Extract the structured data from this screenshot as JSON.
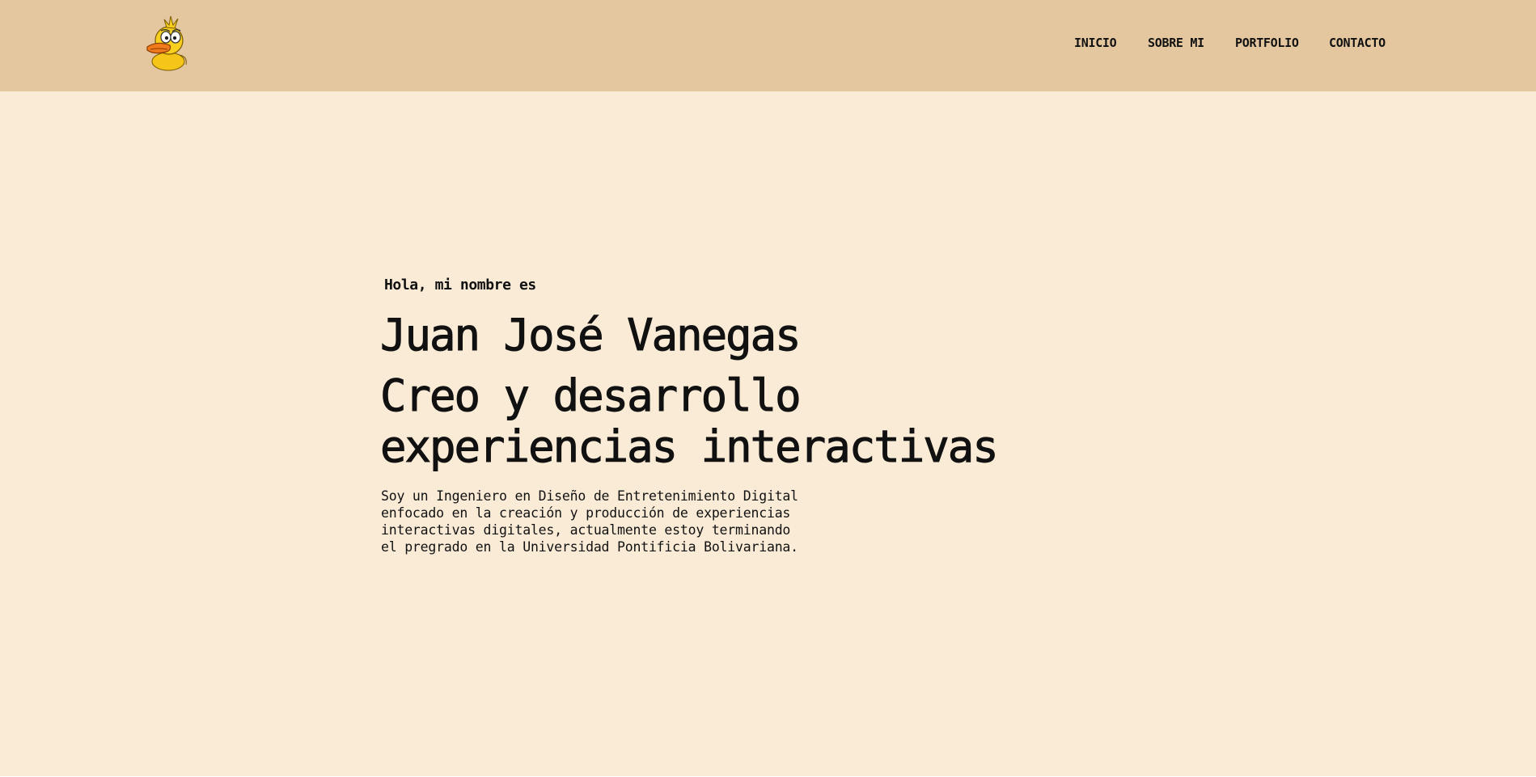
{
  "colors": {
    "header_bg": "#e4c79f",
    "page_bg": "#faebd7",
    "text": "#111111",
    "duck_body": "#f5c518",
    "duck_beak": "#f07a1c"
  },
  "logo": {
    "icon": "duck-mascot-icon"
  },
  "nav": {
    "items": [
      {
        "label": "INICIO"
      },
      {
        "label": "SOBRE MI"
      },
      {
        "label": "PORTFOLIO"
      },
      {
        "label": "CONTACTO"
      }
    ]
  },
  "hero": {
    "greeting": "Hola, mi nombre es",
    "name": "Juan José Vanegas",
    "tagline_lines": [
      "Creo y desarrollo",
      "experiencias interactivas"
    ],
    "bio_lines": [
      "Soy un Ingeniero en Diseño de Entretenimiento Digital",
      "enfocado en la creación y producción de experiencias",
      "interactivas digitales, actualmente estoy terminando",
      "el pregrado en la Universidad Pontificia Bolivariana."
    ]
  }
}
